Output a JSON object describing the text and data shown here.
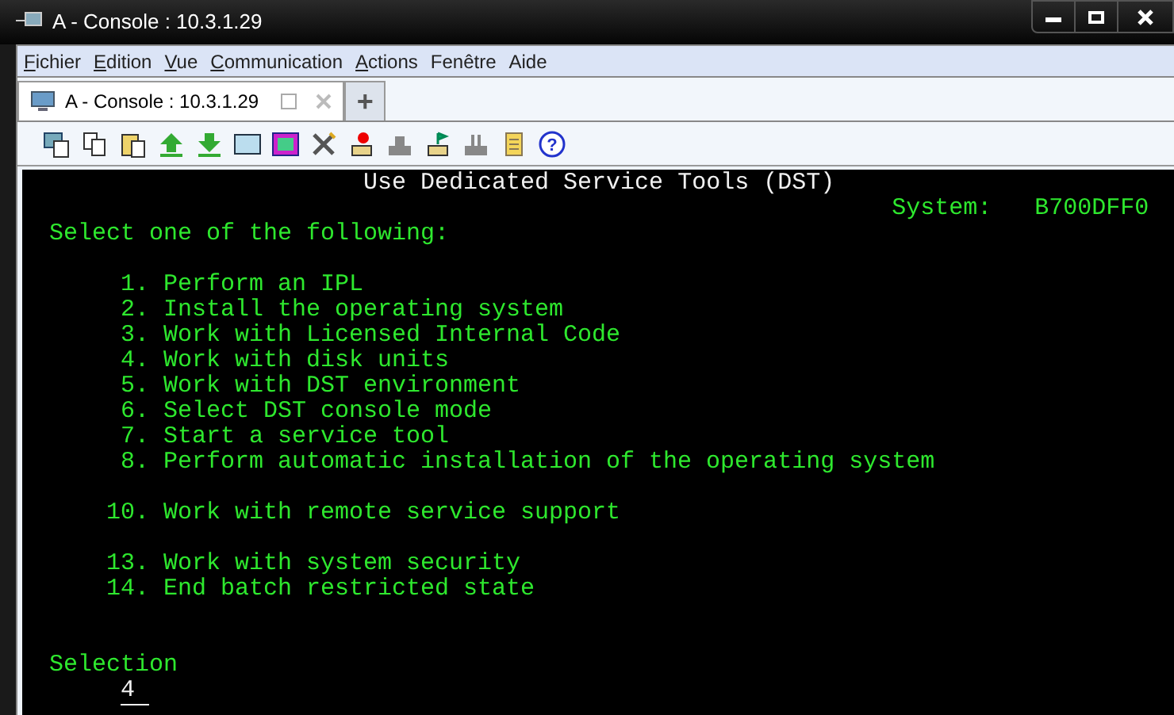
{
  "window": {
    "title": "A - Console : 10.3.1.29"
  },
  "menu": [
    {
      "label": "Fichier",
      "mnemonic": true
    },
    {
      "label": "Edition",
      "mnemonic": true
    },
    {
      "label": "Vue",
      "mnemonic": true
    },
    {
      "label": "Communication",
      "mnemonic": true
    },
    {
      "label": "Actions",
      "mnemonic": true
    },
    {
      "label": "Fenêtre",
      "mnemonic": false
    },
    {
      "label": "Aide",
      "mnemonic": false
    }
  ],
  "tabs": [
    {
      "label": "A - Console : 10.3.1.29",
      "selected": true
    }
  ],
  "new_tab": "+",
  "help_glyph": "?",
  "terminal": {
    "title": "Use Dedicated Service Tools (DST)",
    "system_label": "System:",
    "system_value": "B700DFF0",
    "prompt": "Select one of the following:",
    "groups": [
      {
        "options": [
          {
            "number": "1.",
            "label": "Perform an IPL"
          },
          {
            "number": "2.",
            "label": "Install the operating system"
          },
          {
            "number": "3.",
            "label": "Work with Licensed Internal Code"
          },
          {
            "number": "4.",
            "label": "Work with disk units"
          },
          {
            "number": "5.",
            "label": "Work with DST environment"
          },
          {
            "number": "6.",
            "label": "Select DST console mode"
          },
          {
            "number": "7.",
            "label": "Start a service tool"
          },
          {
            "number": "8.",
            "label": "Perform automatic installation of the operating system"
          }
        ]
      },
      {
        "options": [
          {
            "number": "10.",
            "label": "Work with remote service support"
          }
        ]
      },
      {
        "options": [
          {
            "number": "13.",
            "label": "Work with system security"
          },
          {
            "number": "14.",
            "label": "End batch restricted state"
          }
        ]
      }
    ],
    "selection_label": "Selection",
    "selection_value": "4"
  }
}
